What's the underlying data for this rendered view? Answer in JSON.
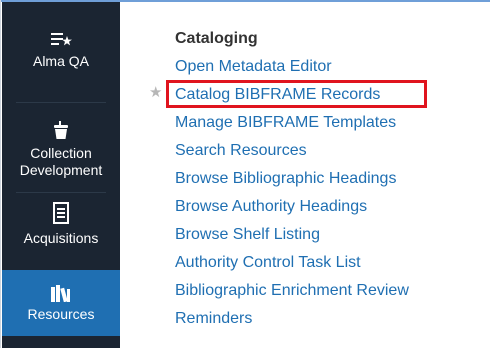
{
  "sidebar": {
    "items": [
      {
        "label": "Alma QA",
        "icon": "alma-qa-icon"
      },
      {
        "label": "Collection\nDevelopment",
        "label_line1": "Collection",
        "label_line2": "Development",
        "icon": "collection-development-icon"
      },
      {
        "label": "Acquisitions",
        "icon": "acquisitions-icon"
      },
      {
        "label": "Resources",
        "icon": "resources-icon",
        "active": true
      }
    ],
    "colors": {
      "background": "#1b2532",
      "active": "#1f6fb2"
    }
  },
  "menu": {
    "title": "Cataloging",
    "items": [
      {
        "label": "Open Metadata Editor"
      },
      {
        "label": "Catalog BIBFRAME Records",
        "starred": true,
        "highlighted": true
      },
      {
        "label": "Manage BIBFRAME Templates"
      },
      {
        "label": "Search Resources"
      },
      {
        "label": "Browse Bibliographic Headings"
      },
      {
        "label": "Browse Authority Headings"
      },
      {
        "label": "Browse Shelf Listing"
      },
      {
        "label": "Authority Control Task List"
      },
      {
        "label": "Bibliographic Enrichment Review"
      },
      {
        "label": "Reminders"
      }
    ],
    "colors": {
      "link": "#1f6fb2",
      "title": "#333333",
      "highlight": "#e0141e",
      "star": "#b7b7b7"
    }
  },
  "icons": {
    "star": "★"
  }
}
